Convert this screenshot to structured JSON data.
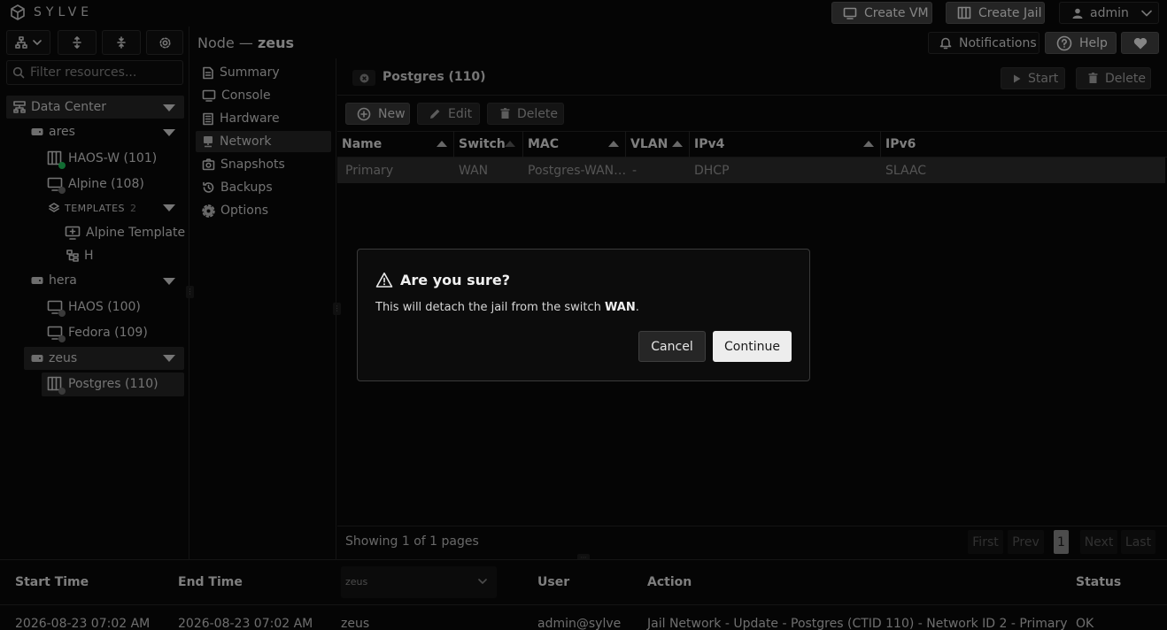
{
  "brand": {
    "name": "SYLVE",
    "icon": "cube-icon"
  },
  "header": {
    "create_vm": "Create VM",
    "create_jail": "Create Jail",
    "user": "admin",
    "notifications": "Notifications",
    "help": "Help"
  },
  "sidebar": {
    "filter_placeholder": "Filter resources...",
    "datacenter": "Data Center",
    "nodes": [
      {
        "name": "ares",
        "items": [
          "HAOS-W (101)",
          "Alpine (108)"
        ],
        "templates_label": "TEMPLATES",
        "templates_count": "2",
        "templates": [
          "Alpine Template",
          "H"
        ]
      },
      {
        "name": "hera",
        "items": [
          "HAOS (100)",
          "Fedora (109)"
        ]
      },
      {
        "name": "zeus",
        "items": [
          "Postgres (110)"
        ]
      }
    ]
  },
  "page": {
    "prefix": "Node —",
    "node": "zeus"
  },
  "menu": [
    "Summary",
    "Console",
    "Hardware",
    "Network",
    "Snapshots",
    "Backups",
    "Options"
  ],
  "resource": {
    "title": "Postgres (110)",
    "start": "Start",
    "delete": "Delete"
  },
  "toolbar": {
    "new": "New",
    "edit": "Edit",
    "delete": "Delete"
  },
  "table": {
    "columns": [
      "Name",
      "Switch",
      "MAC",
      "VLAN",
      "IPv4",
      "IPv6"
    ],
    "rows": [
      [
        "Primary",
        "WAN",
        "Postgres-WAN…",
        "-",
        "DHCP",
        "SLAAC"
      ]
    ]
  },
  "pagination": {
    "summary": "Showing 1 of 1 pages",
    "first": "First",
    "prev": "Prev",
    "page": "1",
    "next": "Next",
    "last": "Last"
  },
  "dialog": {
    "title": "Are you sure?",
    "message_before": "This will detach the jail from the switch ",
    "message_switch": "WAN",
    "message_after": ".",
    "cancel": "Cancel",
    "continue": "Continue"
  },
  "log": {
    "columns": [
      "Start Time",
      "End Time",
      "User",
      "Action",
      "Status"
    ],
    "node_filter": "zeus",
    "rows": [
      [
        "2026-08-23 07:02 AM",
        "2026-08-23 07:02 AM",
        "zeus",
        "admin@sylve",
        "Jail Network - Update - Postgres (CTID 110) - Network ID 2 - Primary",
        "OK"
      ]
    ]
  },
  "colors": {
    "accent_running": "#22c55e",
    "stopped": "#6b6b6b",
    "dialog_bg": "#0c0c0c"
  }
}
